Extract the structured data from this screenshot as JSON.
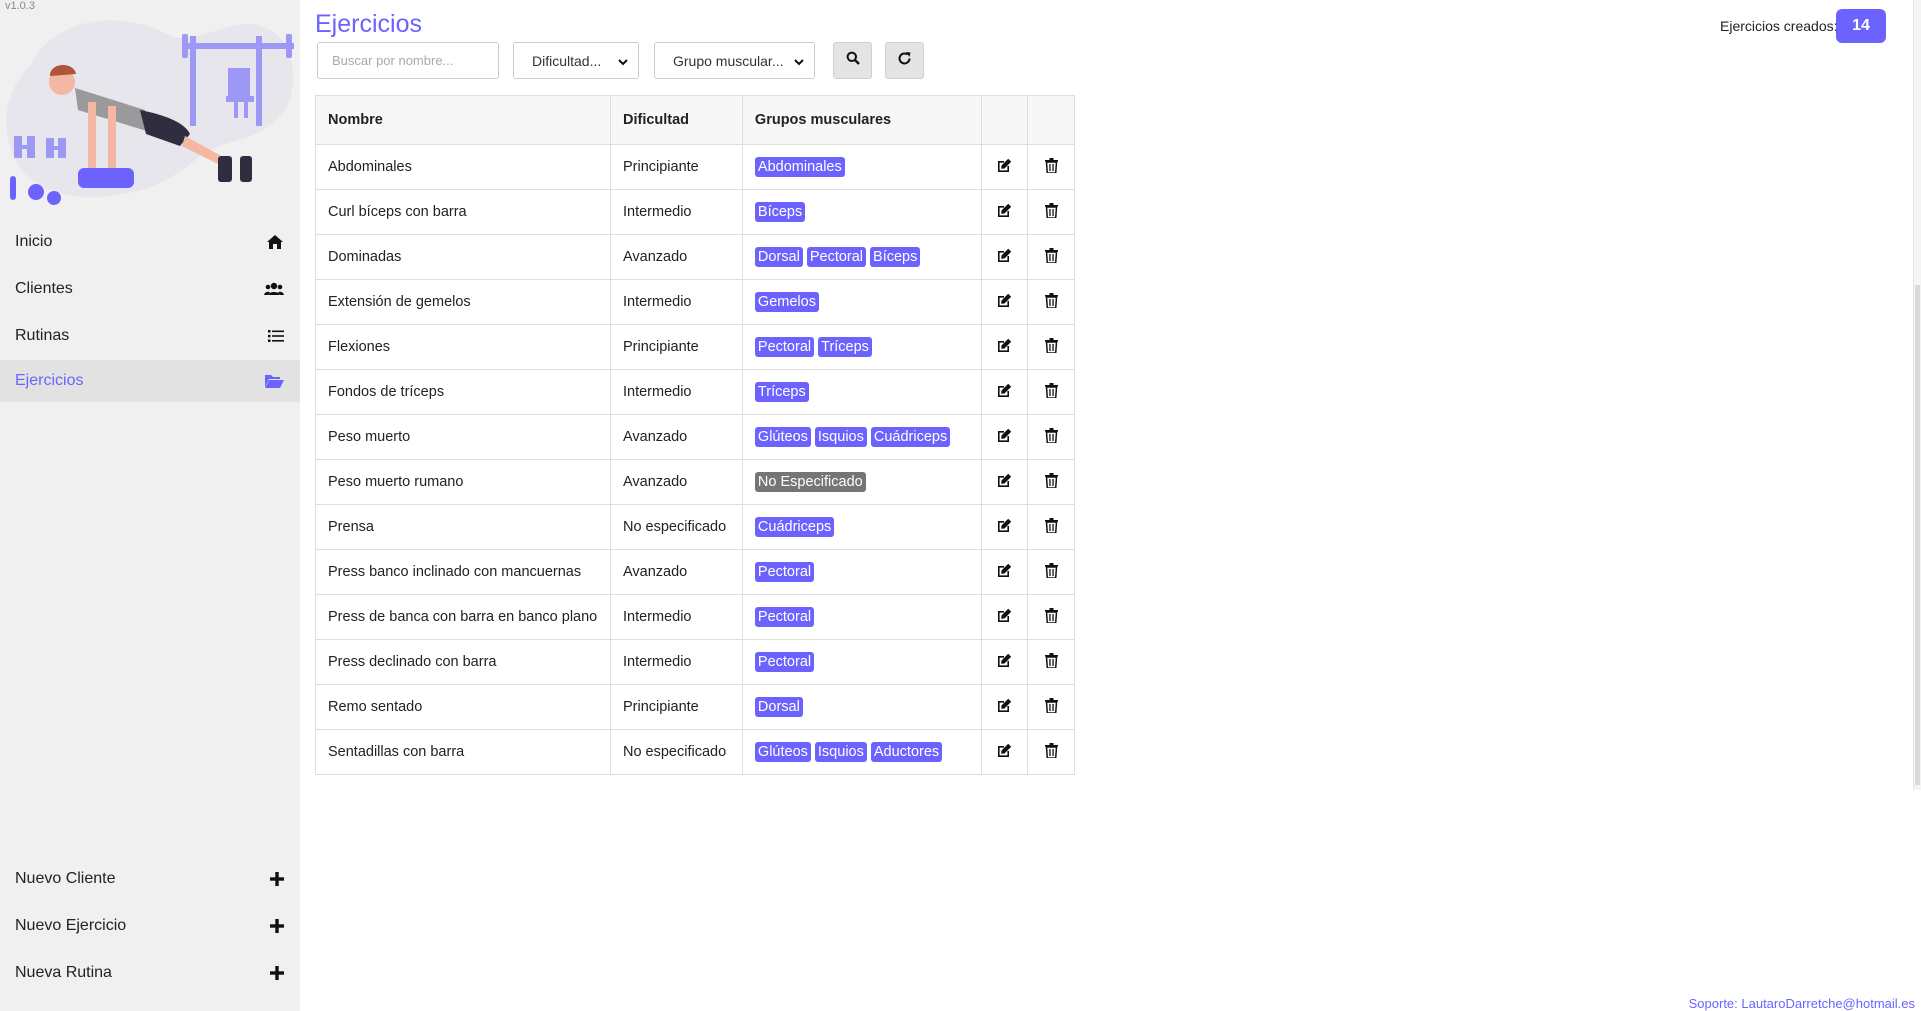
{
  "app": {
    "version": "v1.0.3"
  },
  "sidebar": {
    "nav": [
      {
        "label": "Inicio",
        "icon": "home-icon"
      },
      {
        "label": "Clientes",
        "icon": "users-icon"
      },
      {
        "label": "Rutinas",
        "icon": "list-icon"
      },
      {
        "label": "Ejercicios",
        "icon": "folder-open-icon",
        "active": true
      }
    ],
    "actions": [
      {
        "label": "Nuevo Cliente",
        "icon": "plus-icon"
      },
      {
        "label": "Nuevo Ejercicio",
        "icon": "plus-icon"
      },
      {
        "label": "Nueva Rutina",
        "icon": "plus-icon"
      }
    ]
  },
  "main": {
    "title": "Ejercicios",
    "search_placeholder": "Buscar por nombre...",
    "difficulty_select": "Dificultad...",
    "muscle_select": "Grupo muscular...",
    "counter_label": "Ejercicios creados:",
    "counter_value": "14",
    "table": {
      "headers": [
        "Nombre",
        "Dificultad",
        "Grupos musculares",
        "",
        ""
      ],
      "rows": [
        {
          "name": "Abdominales",
          "difficulty": "Principiante",
          "groups": [
            "Abdominales"
          ]
        },
        {
          "name": "Curl bíceps con barra",
          "difficulty": "Intermedio",
          "groups": [
            "Bíceps"
          ]
        },
        {
          "name": "Dominadas",
          "difficulty": "Avanzado",
          "groups": [
            "Dorsal",
            "Pectoral",
            "Bíceps"
          ]
        },
        {
          "name": "Extensión de gemelos",
          "difficulty": "Intermedio",
          "groups": [
            "Gemelos"
          ]
        },
        {
          "name": "Flexiones",
          "difficulty": "Principiante",
          "groups": [
            "Pectoral",
            "Tríceps"
          ]
        },
        {
          "name": "Fondos de tríceps",
          "difficulty": "Intermedio",
          "groups": [
            "Tríceps"
          ]
        },
        {
          "name": "Peso muerto",
          "difficulty": "Avanzado",
          "groups": [
            "Glúteos",
            "Isquios",
            "Cuádriceps"
          ]
        },
        {
          "name": "Peso muerto rumano",
          "difficulty": "Avanzado",
          "groups": [
            "No Especificado"
          ],
          "unspecified": true
        },
        {
          "name": "Prensa",
          "difficulty": "No especificado",
          "groups": [
            "Cuádriceps"
          ]
        },
        {
          "name": "Press banco inclinado con mancuernas",
          "difficulty": "Avanzado",
          "groups": [
            "Pectoral"
          ]
        },
        {
          "name": "Press de banca con barra en banco plano",
          "difficulty": "Intermedio",
          "groups": [
            "Pectoral"
          ]
        },
        {
          "name": "Press declinado con barra",
          "difficulty": "Intermedio",
          "groups": [
            "Pectoral"
          ]
        },
        {
          "name": "Remo sentado",
          "difficulty": "Principiante",
          "groups": [
            "Dorsal"
          ]
        },
        {
          "name": "Sentadillas con barra",
          "difficulty": "No especificado",
          "groups": [
            "Glúteos",
            "Isquios",
            "Aductores"
          ]
        }
      ]
    }
  },
  "footer": {
    "support": "Soporte: LautaroDarretche@hotmail.es"
  },
  "colors": {
    "accent": "#6c63ff",
    "tag_gray": "#757575",
    "sidebar_bg": "#f0f0f0"
  }
}
